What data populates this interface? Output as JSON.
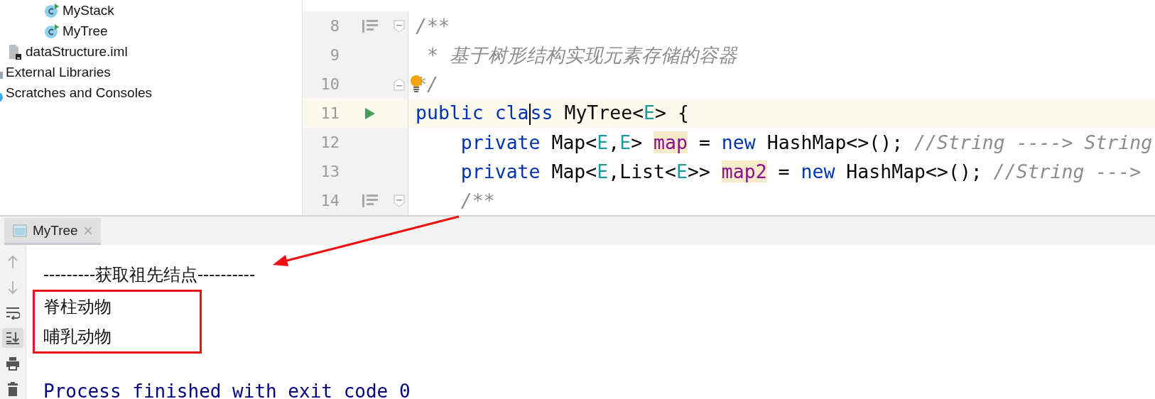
{
  "project_tree": [
    {
      "children": [
        {
          "children": [
            {
              "children": [
                {
                  "label": "MyStack",
                  "kind": "class"
                },
                {
                  "label": "MyTree",
                  "kind": "class"
                }
              ]
            }
          ]
        },
        {
          "label": "dataStructure.iml",
          "kind": "iml"
        }
      ]
    },
    {
      "label": "External Libraries",
      "kind": "library"
    },
    {
      "label": "Scratches and Consoles",
      "kind": "scratches"
    }
  ],
  "editor": {
    "lines": [
      {
        "number": "8",
        "current": false,
        "outline_marker": true,
        "run_marker": false,
        "fold_start": true,
        "fold_end": false,
        "intention": false,
        "tokens": [
          {
            "text": "/**",
            "kind": "comment"
          }
        ]
      },
      {
        "number": "9",
        "current": false,
        "outline_marker": false,
        "run_marker": false,
        "fold_start": false,
        "fold_end": false,
        "intention": false,
        "tokens": [
          {
            "text": " * 基于树形结构实现元素存储的容器",
            "kind": "comment"
          }
        ]
      },
      {
        "number": "10",
        "current": false,
        "outline_marker": false,
        "run_marker": false,
        "fold_start": false,
        "fold_end": true,
        "intention": true,
        "tokens": [
          {
            "text": "*/",
            "kind": "comment"
          }
        ]
      },
      {
        "number": "11",
        "current": true,
        "outline_marker": false,
        "run_marker": true,
        "fold_start": false,
        "fold_end": false,
        "intention": false,
        "tokens": [
          {
            "text": "public cla",
            "kind": "keyword"
          },
          {
            "text": "ss",
            "kind": "keyword",
            "caret": true
          },
          {
            "text": " MyTree<",
            "kind": "plain"
          },
          {
            "text": "E",
            "kind": "type-param"
          },
          {
            "text": "> {",
            "kind": "plain"
          }
        ]
      },
      {
        "number": "12",
        "current": false,
        "outline_marker": false,
        "run_marker": false,
        "fold_start": false,
        "fold_end": false,
        "intention": false,
        "tokens": [
          {
            "text": "    private",
            "kind": "keyword"
          },
          {
            "text": " Map<",
            "kind": "plain"
          },
          {
            "text": "E",
            "kind": "type-param"
          },
          {
            "text": ",",
            "kind": "plain"
          },
          {
            "text": "E",
            "kind": "type-param"
          },
          {
            "text": "> ",
            "kind": "plain"
          },
          {
            "text": "map",
            "kind": "field-usage"
          },
          {
            "text": " = ",
            "kind": "plain"
          },
          {
            "text": "new",
            "kind": "keyword"
          },
          {
            "text": " HashMap<>(); ",
            "kind": "plain"
          },
          {
            "text": "//String ----> String",
            "kind": "comment"
          }
        ]
      },
      {
        "number": "13",
        "current": false,
        "outline_marker": false,
        "run_marker": false,
        "fold_start": false,
        "fold_end": false,
        "intention": false,
        "tokens": [
          {
            "text": "    private",
            "kind": "keyword"
          },
          {
            "text": " Map<",
            "kind": "plain"
          },
          {
            "text": "E",
            "kind": "type-param"
          },
          {
            "text": ",List<",
            "kind": "plain"
          },
          {
            "text": "E",
            "kind": "type-param"
          },
          {
            "text": ">> ",
            "kind": "plain"
          },
          {
            "text": "map2",
            "kind": "field-usage"
          },
          {
            "text": " = ",
            "kind": "plain"
          },
          {
            "text": "new",
            "kind": "keyword"
          },
          {
            "text": " HashMap<>(); ",
            "kind": "plain"
          },
          {
            "text": "//String --->",
            "kind": "comment"
          }
        ]
      },
      {
        "number": "14",
        "current": false,
        "outline_marker": true,
        "run_marker": false,
        "fold_start": true,
        "fold_end": false,
        "intention": false,
        "tokens": [
          {
            "text": "    /**",
            "kind": "comment"
          }
        ]
      }
    ]
  },
  "run_panel": {
    "tabs": [
      {
        "label": "MyTree",
        "selected": true
      }
    ],
    "toolbar": [
      {
        "kind": "up",
        "disabled": true,
        "on": false
      },
      {
        "kind": "down",
        "disabled": true,
        "on": false
      },
      {
        "kind": "wrap",
        "disabled": false,
        "on": false
      },
      {
        "kind": "scroll-end",
        "disabled": false,
        "on": true
      },
      {
        "kind": "print",
        "disabled": false,
        "on": false
      },
      {
        "kind": "trash",
        "disabled": false,
        "on": false
      }
    ],
    "output": [
      {
        "kind": "text",
        "text": "---------获取祖先结点----------"
      },
      {
        "kind": "boxed",
        "lines": [
          "脊柱动物",
          "哺乳动物"
        ]
      },
      {
        "kind": "blank"
      },
      {
        "kind": "exit",
        "text": "Process finished with exit code 0"
      }
    ]
  }
}
